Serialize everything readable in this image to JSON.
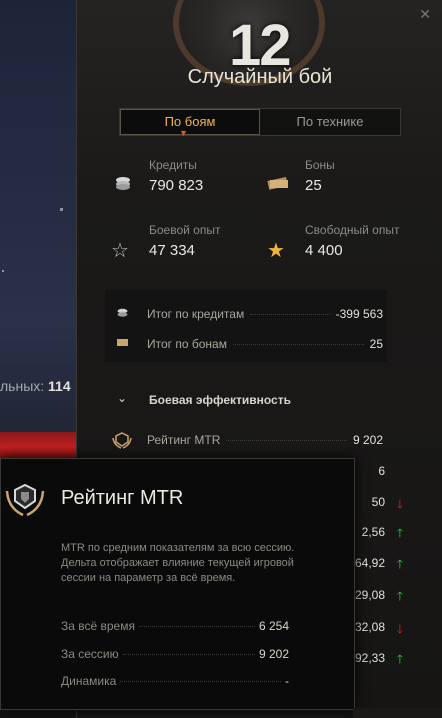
{
  "background": {
    "battles_label": "льных:",
    "battles_value": "114"
  },
  "header": {
    "level": "12",
    "battle_type": "Случайный бой",
    "close_icon": "close-icon"
  },
  "tabs": [
    {
      "label": "По боям",
      "active": true
    },
    {
      "label": "По технике",
      "active": false
    }
  ],
  "stats": {
    "credits": {
      "label": "Кредиты",
      "value": "790 823"
    },
    "bonds": {
      "label": "Боны",
      "value": "25"
    },
    "combat_xp": {
      "label": "Боевой опыт",
      "value": "47 334"
    },
    "free_xp": {
      "label": "Свободный опыт",
      "value": "4 400"
    }
  },
  "summary": {
    "credits_total": {
      "label": "Итог по кредитам",
      "value": "-399 563"
    },
    "bonds_total": {
      "label": "Итог по бонам",
      "value": "25"
    }
  },
  "efficiency": {
    "title": "Боевая эффективность",
    "mtr": {
      "label": "Рейтинг MTR",
      "value": "9 202"
    },
    "values": [
      {
        "value": "6",
        "trend": ""
      },
      {
        "value": "50",
        "trend": "down"
      },
      {
        "value": "2,56",
        "trend": "up"
      },
      {
        "value": "64,92",
        "trend": "up"
      },
      {
        "value": "29,08",
        "trend": "up"
      },
      {
        "value": "32,08",
        "trend": "down"
      },
      {
        "value": "92,33",
        "trend": "up"
      }
    ]
  },
  "tooltip": {
    "title": "Рейтинг MTR",
    "description": "MTR по средним показателям за всю сессию. Дельта отображает влияние текущей игровой сессии на параметр за всё время.",
    "rows": [
      {
        "label": "За всё время",
        "value": "6 254"
      },
      {
        "label": "За сессию",
        "value": "9 202"
      },
      {
        "label": "Динамика",
        "value": "-"
      }
    ]
  },
  "colors": {
    "accent": "#f2b54a",
    "up": "#29d43a",
    "down": "#d62828"
  }
}
